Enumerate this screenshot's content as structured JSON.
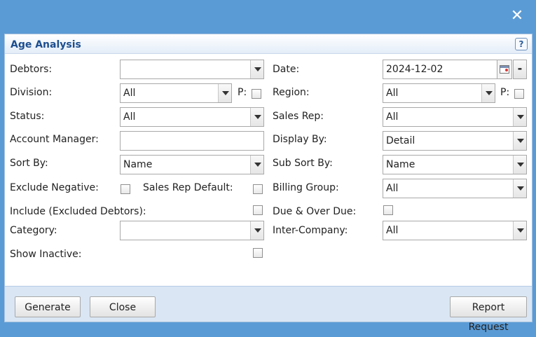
{
  "window": {
    "title": "Age Analysis",
    "help": "?",
    "close": "✕"
  },
  "left": {
    "debtors": {
      "label": "Debtors:",
      "value": ""
    },
    "division": {
      "label": "Division:",
      "value": "All",
      "p_label": "P:"
    },
    "status": {
      "label": "Status:",
      "value": "All"
    },
    "account_manager": {
      "label": "Account Manager:",
      "value": ""
    },
    "sort_by": {
      "label": "Sort By:",
      "value": "Name"
    },
    "exclude_negative": {
      "label": "Exclude Negative:",
      "checked": false
    },
    "sales_rep_default": {
      "label": "Sales Rep Default:",
      "checked": false
    },
    "include_excluded": {
      "label": "Include (Excluded Debtors):",
      "checked": false
    },
    "category": {
      "label": "Category:",
      "value": ""
    },
    "show_inactive": {
      "label": "Show Inactive:",
      "checked": false
    }
  },
  "right": {
    "date": {
      "label": "Date:",
      "value": "2024-12-02",
      "clear": "-"
    },
    "region": {
      "label": "Region:",
      "value": "All",
      "p_label": "P:"
    },
    "sales_rep": {
      "label": "Sales Rep:",
      "value": "All"
    },
    "display_by": {
      "label": "Display By:",
      "value": "Detail"
    },
    "sub_sort_by": {
      "label": "Sub Sort By:",
      "value": "Name"
    },
    "billing_group": {
      "label": "Billing Group:",
      "value": "All"
    },
    "due_over_due": {
      "label": "Due & Over Due:",
      "checked": false
    },
    "inter_company": {
      "label": "Inter-Company:",
      "value": "All"
    }
  },
  "footer": {
    "generate": "Generate",
    "close": "Close",
    "report_request": "Report Request"
  },
  "colors": {
    "titlebar": "#5b9bd5",
    "panel": "#dae6f4",
    "title_text": "#1d4e8f"
  }
}
